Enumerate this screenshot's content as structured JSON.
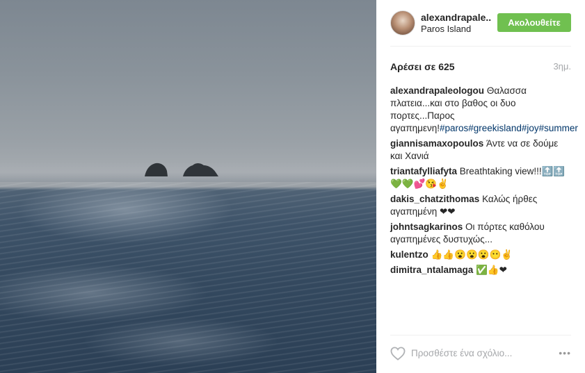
{
  "post": {
    "username": "alexandrapale..",
    "location": "Paros Island",
    "follow_label": "Ακολουθείτε",
    "likes_label": "Αρέσει σε 625",
    "time_ago": "3ημ."
  },
  "caption": {
    "user": "alexandrapaleologou",
    "text": "Θαλασσα πλατεια...και στο βαθος οι δυο πορτες...Παρος αγαπημενη!",
    "hashtags": [
      "#paros",
      "#greekisland",
      "#joy",
      "#summer"
    ]
  },
  "comments": [
    {
      "user": "giannisamaxopoulos",
      "text": "Άντε να σε δούμε και Χανιά"
    },
    {
      "user": "triantafylliafyta",
      "text": "Breathtaking view!!!🔝🔝💚💚💕😘✌"
    },
    {
      "user": "dakis_chatzithomas",
      "text": "Καλώς ήρθες αγαπημένη ❤❤"
    },
    {
      "user": "johntsagkarinos",
      "text": "Οι πόρτες καθόλου αγαπημένες δυστυχώς..."
    },
    {
      "user": "kulentzo",
      "text": "👍👍😮😮😮😶✌"
    },
    {
      "user": "dimitra_ntalamaga",
      "text": "✅👍❤"
    }
  ],
  "footer": {
    "comment_placeholder": "Προσθέστε ένα σχόλιο...",
    "like_icon": "heart-outline-icon",
    "more_icon": "more-options-icon",
    "more_label": "•••"
  },
  "colors": {
    "follow_button": "#70c050",
    "hashtag": "#003569",
    "muted": "#a5a7aa"
  }
}
